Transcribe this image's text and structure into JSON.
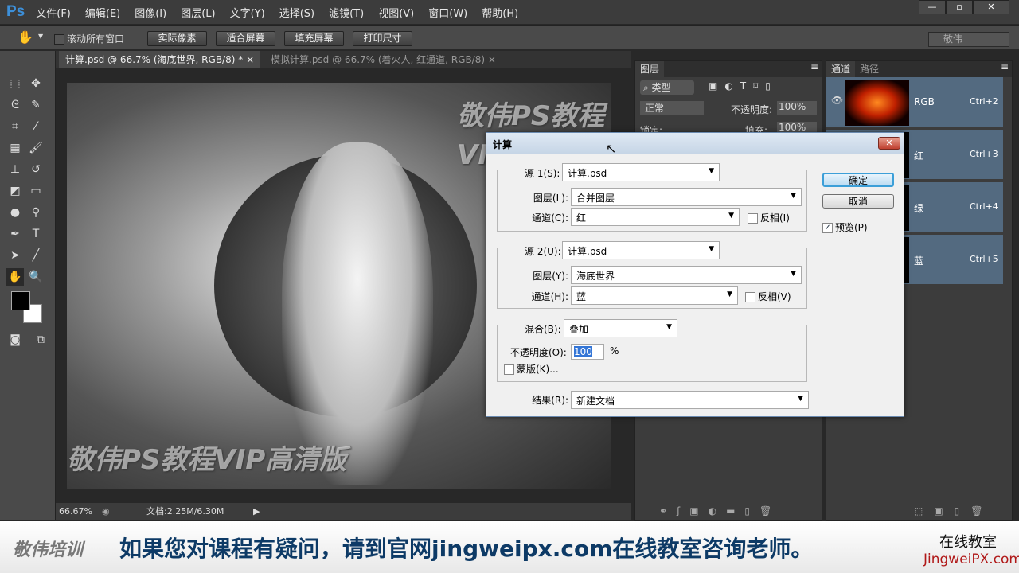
{
  "app": {
    "logo": "Ps",
    "menu": [
      "文件(F)",
      "编辑(E)",
      "图像(I)",
      "图层(L)",
      "文字(Y)",
      "选择(S)",
      "滤镜(T)",
      "视图(V)",
      "窗口(W)",
      "帮助(H)"
    ],
    "window_buttons": [
      "—",
      "▫",
      "✕"
    ]
  },
  "options": {
    "scroll_all": "滚动所有窗口",
    "buttons": [
      "实际像素",
      "适合屏幕",
      "填充屏幕",
      "打印尺寸"
    ],
    "workspace": "敬伟"
  },
  "tabs": [
    {
      "label": "计算.psd @ 66.7% (海底世界, RGB/8) *"
    },
    {
      "label": "模拟计算.psd @ 66.7% (着火人, 红通道, RGB/8)"
    }
  ],
  "canvas": {
    "watermark_top": "敬伟PS教程VIP高清版",
    "watermark_bottom": "敬伟PS教程VIP高清版"
  },
  "status": {
    "zoom": "66.67%",
    "doc": "文档:2.25M/6.30M"
  },
  "layers_panel": {
    "tab": "图层",
    "filter": "类型",
    "blend": "正常",
    "opacity_label": "不透明度:",
    "opacity": "100%",
    "lock_label": "锁定:",
    "fill_label": "填充:",
    "fill": "100%"
  },
  "channels_panel": {
    "tabs": [
      "通道",
      "路径"
    ],
    "rows": [
      {
        "name": "RGB",
        "key": "Ctrl+2"
      },
      {
        "name": "红",
        "key": "Ctrl+3"
      },
      {
        "name": "绿",
        "key": "Ctrl+4"
      },
      {
        "name": "蓝",
        "key": "Ctrl+5"
      }
    ]
  },
  "dialog": {
    "title": "计算",
    "close": "✕",
    "source1": {
      "label": "源 1(S):",
      "file": "计算.psd",
      "layer_label": "图层(L):",
      "layer": "合并图层",
      "channel_label": "通道(C):",
      "channel": "红",
      "invert": "反相(I)"
    },
    "source2": {
      "label": "源 2(U):",
      "file": "计算.psd",
      "layer_label": "图层(Y):",
      "layer": "海底世界",
      "channel_label": "通道(H):",
      "channel": "蓝",
      "invert": "反相(V)"
    },
    "blend": {
      "label": "混合(B):",
      "mode": "叠加",
      "opacity_label": "不透明度(O):",
      "opacity": "100",
      "percent": "%",
      "mask": "蒙版(K)..."
    },
    "result": {
      "label": "结果(R):",
      "value": "新建文档"
    },
    "ok": "确定",
    "cancel": "取消",
    "preview": "预览(P)",
    "preview_checked": true
  },
  "footer": {
    "brand": "敬伟培训",
    "message": "如果您对课程有疑问，请到官网jingweipx.com在线教室咨询老师。",
    "right_title": "在线教室",
    "right_url": "JingweiPX.com"
  }
}
